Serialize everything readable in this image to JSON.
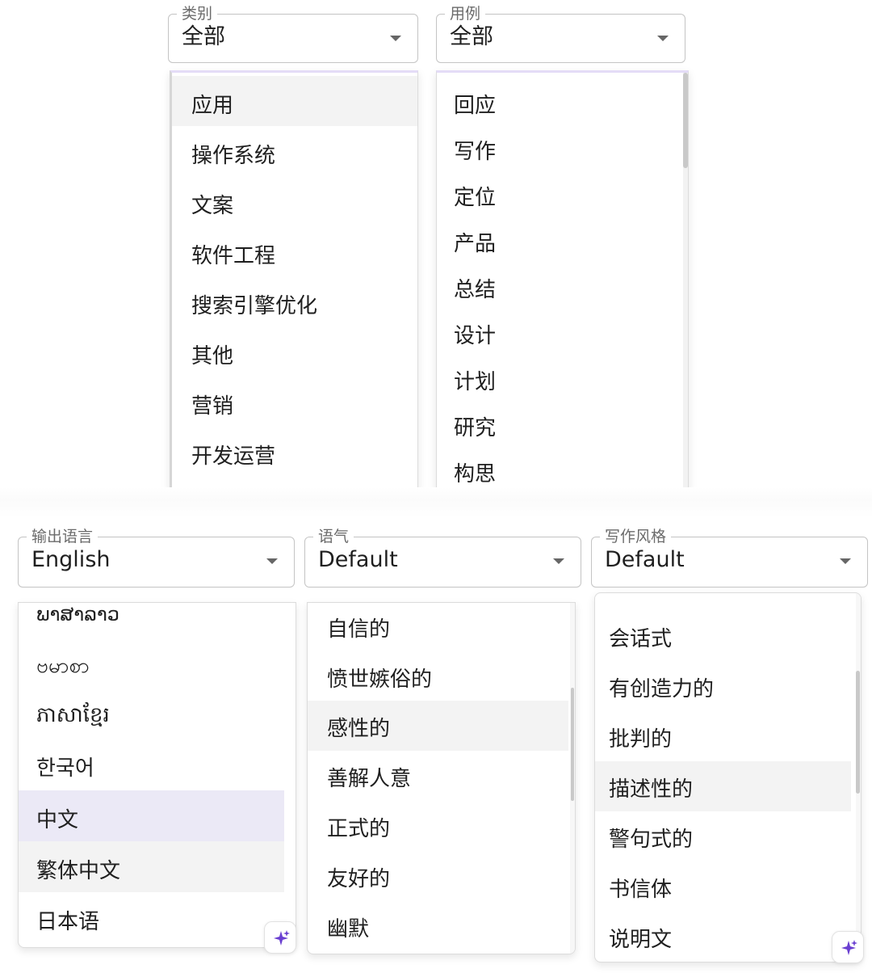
{
  "category_select": {
    "label": "类别",
    "value": "全部"
  },
  "usecase_select": {
    "label": "用例",
    "value": "全部"
  },
  "category_options": [
    "应用",
    "操作系统",
    "文案",
    "软件工程",
    "搜索引擎优化",
    "其他",
    "营销",
    "开发运营"
  ],
  "usecase_options": [
    "回应",
    "写作",
    "定位",
    "产品",
    "总结",
    "设计",
    "计划",
    "研究",
    "构思"
  ],
  "language_select": {
    "label": "输出语言",
    "value": "English"
  },
  "tone_select": {
    "label": "语气",
    "value": "Default"
  },
  "style_select": {
    "label": "写作风格",
    "value": "Default"
  },
  "language_options": [
    "ພາສາລາວ",
    "ဗမာစာ",
    "ភាសាខ្មែរ",
    "한국어",
    "中文",
    "繁体中文",
    "日本语"
  ],
  "tone_options": [
    "自信的",
    "愤世嫉俗的",
    "感性的",
    "善解人意",
    "正式的",
    "友好的",
    "幽默"
  ],
  "style_options": [
    "会话式",
    "有创造力的",
    "批判的",
    "描述性的",
    "警句式的",
    "书信体",
    "说明文"
  ],
  "colors": {
    "accent_sparkle": "#6a3fd1",
    "selected_bg": "#ebe9f6",
    "hover_bg": "#f3f3f3"
  },
  "icons": {
    "caret": "caret-down-icon",
    "sparkle": "sparkle-icon"
  }
}
